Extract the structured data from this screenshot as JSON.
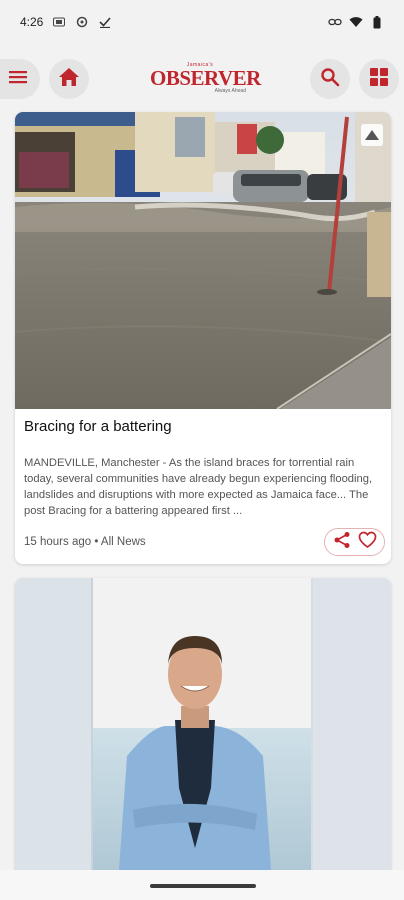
{
  "status_bar": {
    "time": "4:26",
    "left_icons": [
      "sim-icon",
      "settings-icon",
      "check-icon"
    ],
    "right_icons": [
      "link-icon",
      "wifi-icon",
      "battery-icon"
    ]
  },
  "app_bar": {
    "logo_top": "Jamaica's",
    "logo_main": "OBSERVER",
    "logo_sub": "Always Ahead",
    "accent_color": "#c0262d"
  },
  "articles": [
    {
      "headline": "Bracing for a battering",
      "excerpt": "MANDEVILLE, Manchester - As the island braces for torrential rain today, several communities have already begun experiencing flooding, landslides and disruptions with more expected as Jamaica face... The post Bracing for a battering appeared first ...",
      "meta": "15 hours ago • All News",
      "image": "flooded-street-photo"
    },
    {
      "image": "portrait-man-blue-blazer-photo"
    }
  ]
}
